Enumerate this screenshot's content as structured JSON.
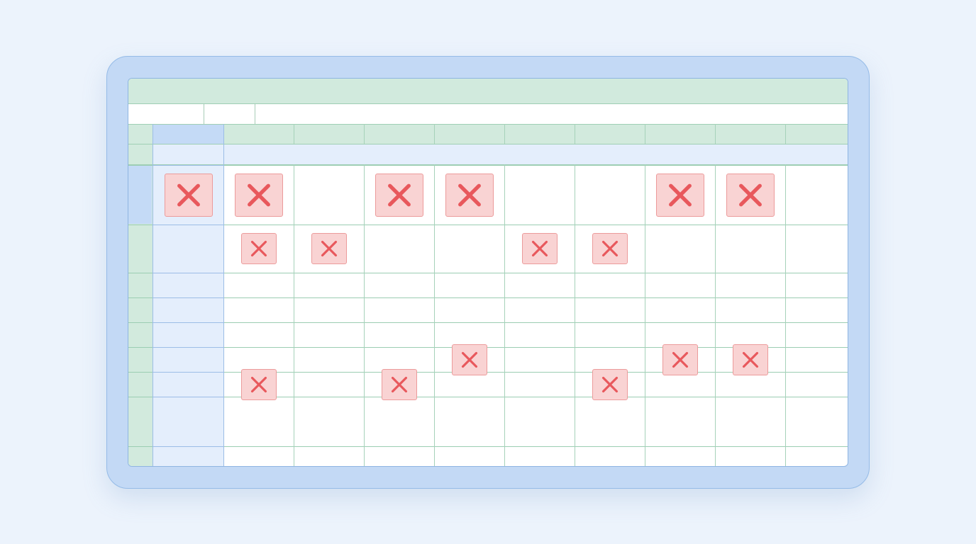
{
  "app": {
    "accent_color": "#c3d9f5",
    "header_color": "#d1eadd",
    "mark_color": "#e8585c",
    "mark_fill": "#f9d3d3"
  },
  "sheet": {
    "columns": 9,
    "rows": [
      {
        "marks": [
          0,
          1,
          3,
          4,
          7,
          8
        ],
        "mark_style": "large"
      },
      {
        "marks": [
          1,
          2,
          5,
          6
        ],
        "mark_style": "small"
      },
      {
        "marks": [],
        "mark_style": "none"
      },
      {
        "marks": [],
        "mark_style": "none"
      },
      {
        "marks": [],
        "mark_style": "none"
      },
      {
        "marks": [
          4,
          7,
          8
        ],
        "mark_style": "small"
      },
      {
        "marks": [
          1,
          3,
          6
        ],
        "mark_style": "small"
      },
      {
        "marks": [],
        "mark_style": "none"
      }
    ],
    "mark_icon": "x-mark-icon"
  }
}
